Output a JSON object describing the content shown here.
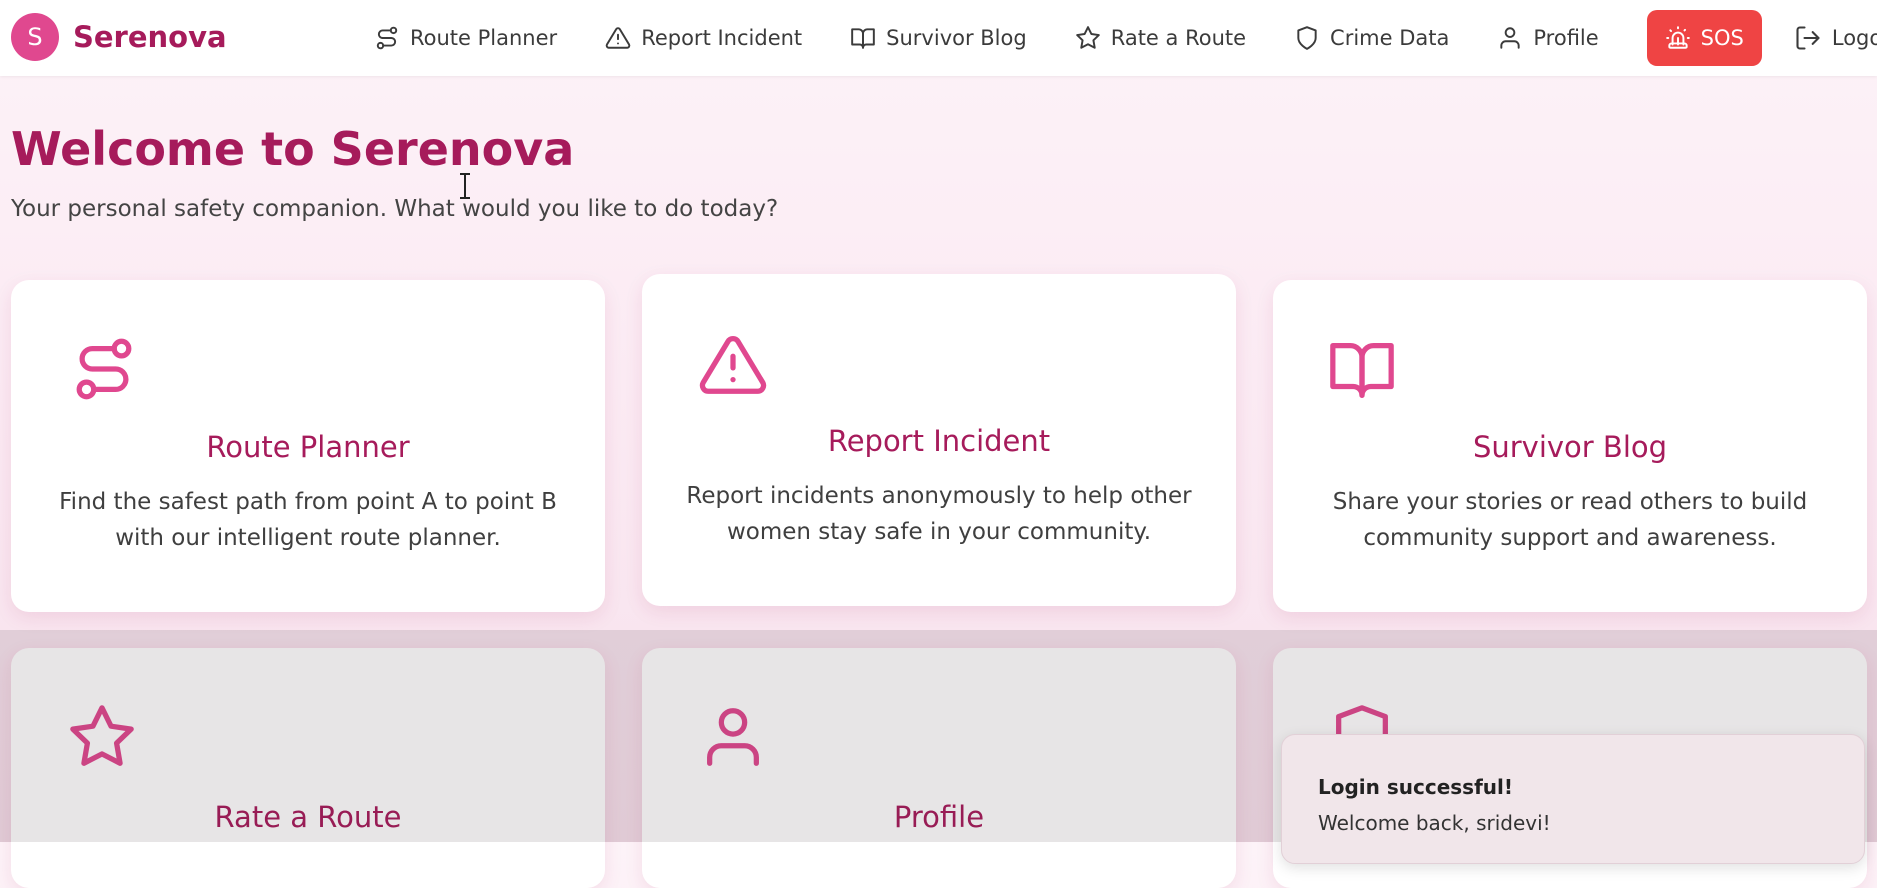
{
  "brand": {
    "logo_letter": "S",
    "name": "Serenova",
    "color": "#a61b5b",
    "accent": "#e0488f"
  },
  "nav": {
    "items": [
      {
        "label": "Route Planner",
        "icon": "route-icon"
      },
      {
        "label": "Report Incident",
        "icon": "alert-triangle-icon"
      },
      {
        "label": "Survivor Blog",
        "icon": "book-open-icon"
      },
      {
        "label": "Rate a Route",
        "icon": "star-icon"
      },
      {
        "label": "Crime Data",
        "icon": "shield-icon"
      },
      {
        "label": "Profile",
        "icon": "user-icon"
      }
    ],
    "sos": {
      "label": "SOS",
      "icon": "siren-icon",
      "color": "#ef4444"
    },
    "logout": {
      "label": "Logout",
      "icon": "logout-icon"
    }
  },
  "main": {
    "title": "Welcome to Serenova",
    "subtitle": "Your personal safety companion. What would you like to do today?"
  },
  "cards": [
    {
      "title": "Route Planner",
      "description": "Find the safest path from point A to point B with our intelligent route planner.",
      "icon": "route-icon"
    },
    {
      "title": "Report Incident",
      "description": "Report incidents anonymously to help other women stay safe in your community.",
      "icon": "alert-triangle-icon"
    },
    {
      "title": "Survivor Blog",
      "description": "Share your stories or read others to build community support and awareness.",
      "icon": "book-open-icon"
    },
    {
      "title": "Rate a Route",
      "description": "",
      "icon": "star-icon"
    },
    {
      "title": "Profile",
      "description": "",
      "icon": "user-icon"
    },
    {
      "title": "",
      "description": "",
      "icon": "shield-icon"
    }
  ],
  "toast": {
    "title": "Login successful!",
    "message": "Welcome back, sridevi!"
  }
}
